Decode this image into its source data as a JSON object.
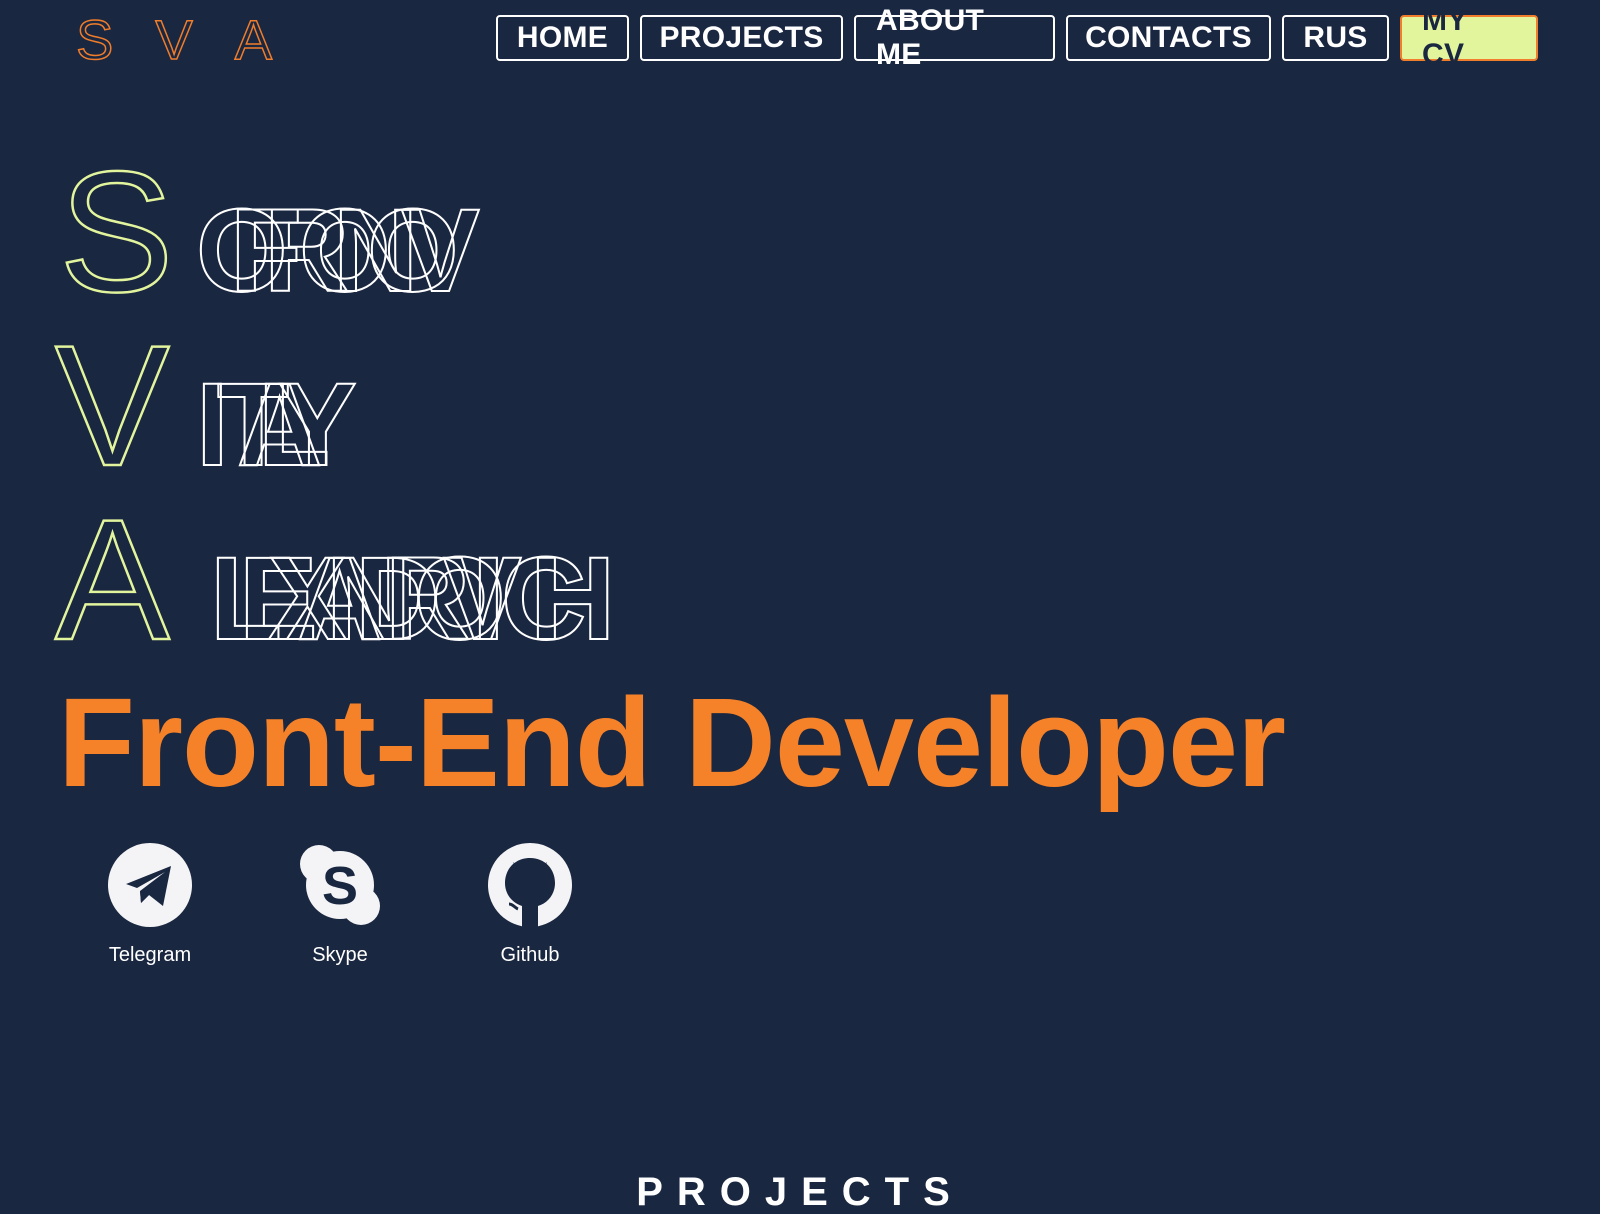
{
  "logo": {
    "letters": [
      "S",
      "V",
      "A"
    ],
    "color": "#f07d2b"
  },
  "nav": {
    "home": "HOME",
    "projects": "PROJECTS",
    "about": "ABOUT ME",
    "contacts": "CONTACTS",
    "lang": "RUS",
    "cv": "MY CV"
  },
  "hero": {
    "surname": {
      "initial": "S",
      "letters": [
        "O",
        "F",
        "R",
        "O",
        "N",
        "O",
        "V"
      ]
    },
    "name": {
      "initial": "V",
      "letters": [
        "I",
        "T",
        "A",
        "L",
        "Y"
      ]
    },
    "patronymic": {
      "initial": "A",
      "letters": [
        "L",
        "E",
        "X",
        "A",
        "N",
        "D",
        "R",
        "O",
        "V",
        "I",
        "C",
        "H"
      ]
    },
    "initial_color": "#e2f59d"
  },
  "role": "Front-End Developer",
  "socials": [
    {
      "label": "Telegram",
      "icon": "telegram-icon"
    },
    {
      "label": "Skype",
      "icon": "skype-icon"
    },
    {
      "label": "Github",
      "icon": "github-icon"
    }
  ],
  "section": {
    "title": "PROJECTS"
  },
  "colors": {
    "background": "#1a2740",
    "accent_orange": "#f58128",
    "accent_lime": "#e2f59d"
  }
}
